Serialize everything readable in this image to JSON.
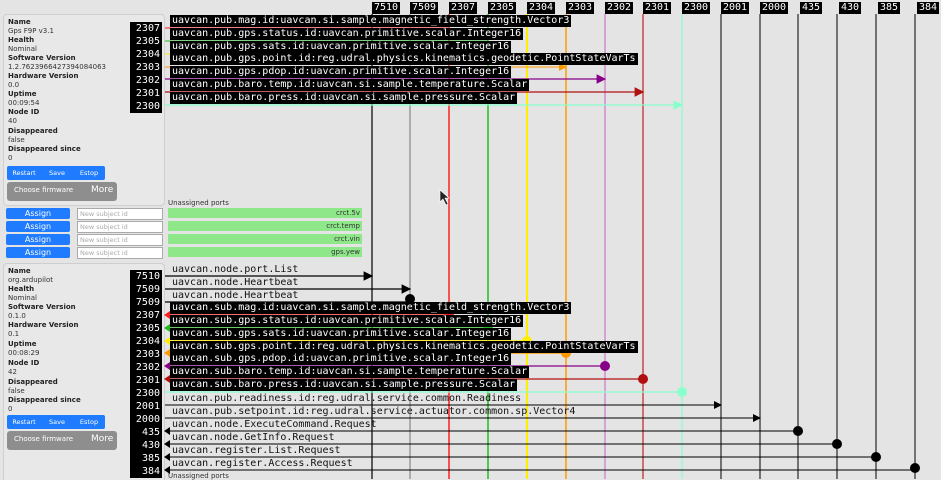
{
  "node1": {
    "fields": [
      {
        "key": "Name",
        "value": "Gps F9P v3.1"
      },
      {
        "key": "Health",
        "value": "Nominal"
      },
      {
        "key": "Software Version",
        "value": "1.2.7623966427394084063"
      },
      {
        "key": "Hardware Version",
        "value": "0.0"
      },
      {
        "key": "Uptime",
        "value": "00:09:54"
      },
      {
        "key": "Node ID",
        "value": "40"
      },
      {
        "key": "Disappeared",
        "value": "false"
      },
      {
        "key": "Disappeared since",
        "value": "0"
      }
    ],
    "ports": [
      "2307",
      "2305",
      "2304",
      "2303",
      "2302",
      "2301",
      "2300"
    ],
    "buttons": {
      "restart": "Restart",
      "save": "Save",
      "estop": "Estop",
      "choose_firmware": "Choose firmware",
      "more": "More"
    }
  },
  "assign": {
    "label": "Assign",
    "placeholder": "New subject id",
    "unassigned_title": "Unassigned ports",
    "unassigned_ports": [
      "crct.5v",
      "crct.temp",
      "crct.vin",
      "gps.yew"
    ]
  },
  "node2": {
    "fields": [
      {
        "key": "Name",
        "value": "org.ardupilot"
      },
      {
        "key": "Health",
        "value": "Nominal"
      },
      {
        "key": "Software Version",
        "value": "0.1.0"
      },
      {
        "key": "Hardware Version",
        "value": "0.1"
      },
      {
        "key": "Uptime",
        "value": "00:08:29"
      },
      {
        "key": "Node ID",
        "value": "42"
      },
      {
        "key": "Disappeared",
        "value": "false"
      },
      {
        "key": "Disappeared since",
        "value": "0"
      }
    ],
    "ports": [
      "7510",
      "7509",
      "7509",
      "2307",
      "2305",
      "2304",
      "2303",
      "2302",
      "2301",
      "2300",
      "2001",
      "2000",
      "435",
      "430",
      "385",
      "384"
    ],
    "buttons": {
      "restart": "Restart",
      "save": "Save",
      "estop": "Estop",
      "choose_firmware": "Choose firmware",
      "more": "More"
    }
  },
  "bottom_label": "Unassigned ports",
  "header_ports": [
    {
      "label": "7510",
      "color": "#000000"
    },
    {
      "label": "7509",
      "color": "#888888"
    },
    {
      "label": "2307",
      "color": "#ff2020"
    },
    {
      "label": "2305",
      "color": "#22bb22"
    },
    {
      "label": "2304",
      "color": "#ffee00"
    },
    {
      "label": "2303",
      "color": "#ff9900"
    },
    {
      "label": "2302",
      "color": "#cc77cc"
    },
    {
      "label": "2301",
      "color": "#bb2222"
    },
    {
      "label": "2300",
      "color": "#88ffcc"
    },
    {
      "label": "2001",
      "color": "#000000"
    },
    {
      "label": "2000",
      "color": "#000000"
    },
    {
      "label": "435",
      "color": "#000000"
    },
    {
      "label": "430",
      "color": "#000000"
    },
    {
      "label": "385",
      "color": "#000000"
    },
    {
      "label": "384",
      "color": "#000000"
    }
  ],
  "top_topics": [
    "uavcan.pub.mag.id:uavcan.si.sample.magnetic_field_strength.Vector3",
    "uavcan.pub.gps.status.id:uavcan.primitive.scalar.Integer16",
    "uavcan.pub.gps.sats.id:uavcan.primitive.scalar.Integer16",
    "uavcan.pub.gps.point.id:reg.udral.physics.kinematics.geodetic.PointStateVarTs",
    "uavcan.pub.gps.pdop.id:uavcan.primitive.scalar.Integer16",
    "uavcan.pub.baro.temp.id:uavcan.si.sample.temperature.Scalar",
    "uavcan.pub.baro.press.id:uavcan.si.sample.pressure.Scalar"
  ],
  "bottom_topics": [
    "uavcan.node.port.List",
    "uavcan.node.Heartbeat",
    "uavcan.node.Heartbeat",
    "uavcan.sub.mag.id:uavcan.si.sample.magnetic_field_strength.Vector3",
    "uavcan.sub.gps.status.id:uavcan.primitive.scalar.Integer16",
    "uavcan.sub.gps.sats.id:uavcan.primitive.scalar.Integer16",
    "uavcan.sub.gps.point.id:reg.udral.physics.kinematics.geodetic.PointStateVarTs",
    "uavcan.sub.gps.pdop.id:uavcan.primitive.scalar.Integer16",
    "uavcan.sub.baro.temp.id:uavcan.si.sample.temperature.Scalar",
    "uavcan.sub.baro.press.id:uavcan.si.sample.pressure.Scalar",
    "uavcan.pub.readiness.id:reg.udral.service.common.Readiness",
    "uavcan.pub.setpoint.id:reg.udral.service.actuator.common.sp.Vector4",
    "uavcan.node.ExecuteCommand.Request",
    "uavcan.node.GetInfo.Request",
    "uavcan.register.List.Request",
    "uavcan.register.Access.Request"
  ]
}
